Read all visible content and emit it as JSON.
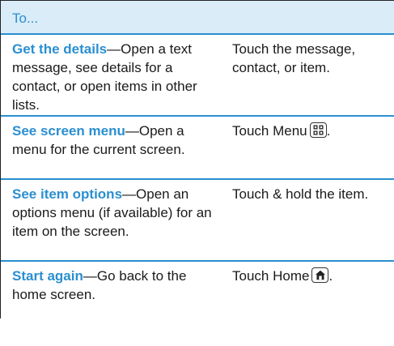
{
  "header": {
    "label": "To..."
  },
  "rows": [
    {
      "term": "Get the details",
      "desc": "—Open a text message, see details for a contact, or open items in other lists.",
      "action": "Touch the message, contact, or item."
    },
    {
      "term": "See screen menu",
      "desc": "—Open a menu for the current screen.",
      "action_pre": "Touch Menu",
      "action_post": ".",
      "icon": "menu-key-icon"
    },
    {
      "term": "See item options",
      "desc": "—Open an options menu (if available) for an item on the screen.",
      "action": "Touch & hold the item."
    },
    {
      "term": "Start again",
      "desc": "—Go back to the home screen.",
      "action_pre": "Touch Home",
      "action_post": ".",
      "icon": "home-key-icon"
    }
  ],
  "colors": {
    "accent": "#2a8fd0",
    "header_bg": "#d9ecf8"
  }
}
